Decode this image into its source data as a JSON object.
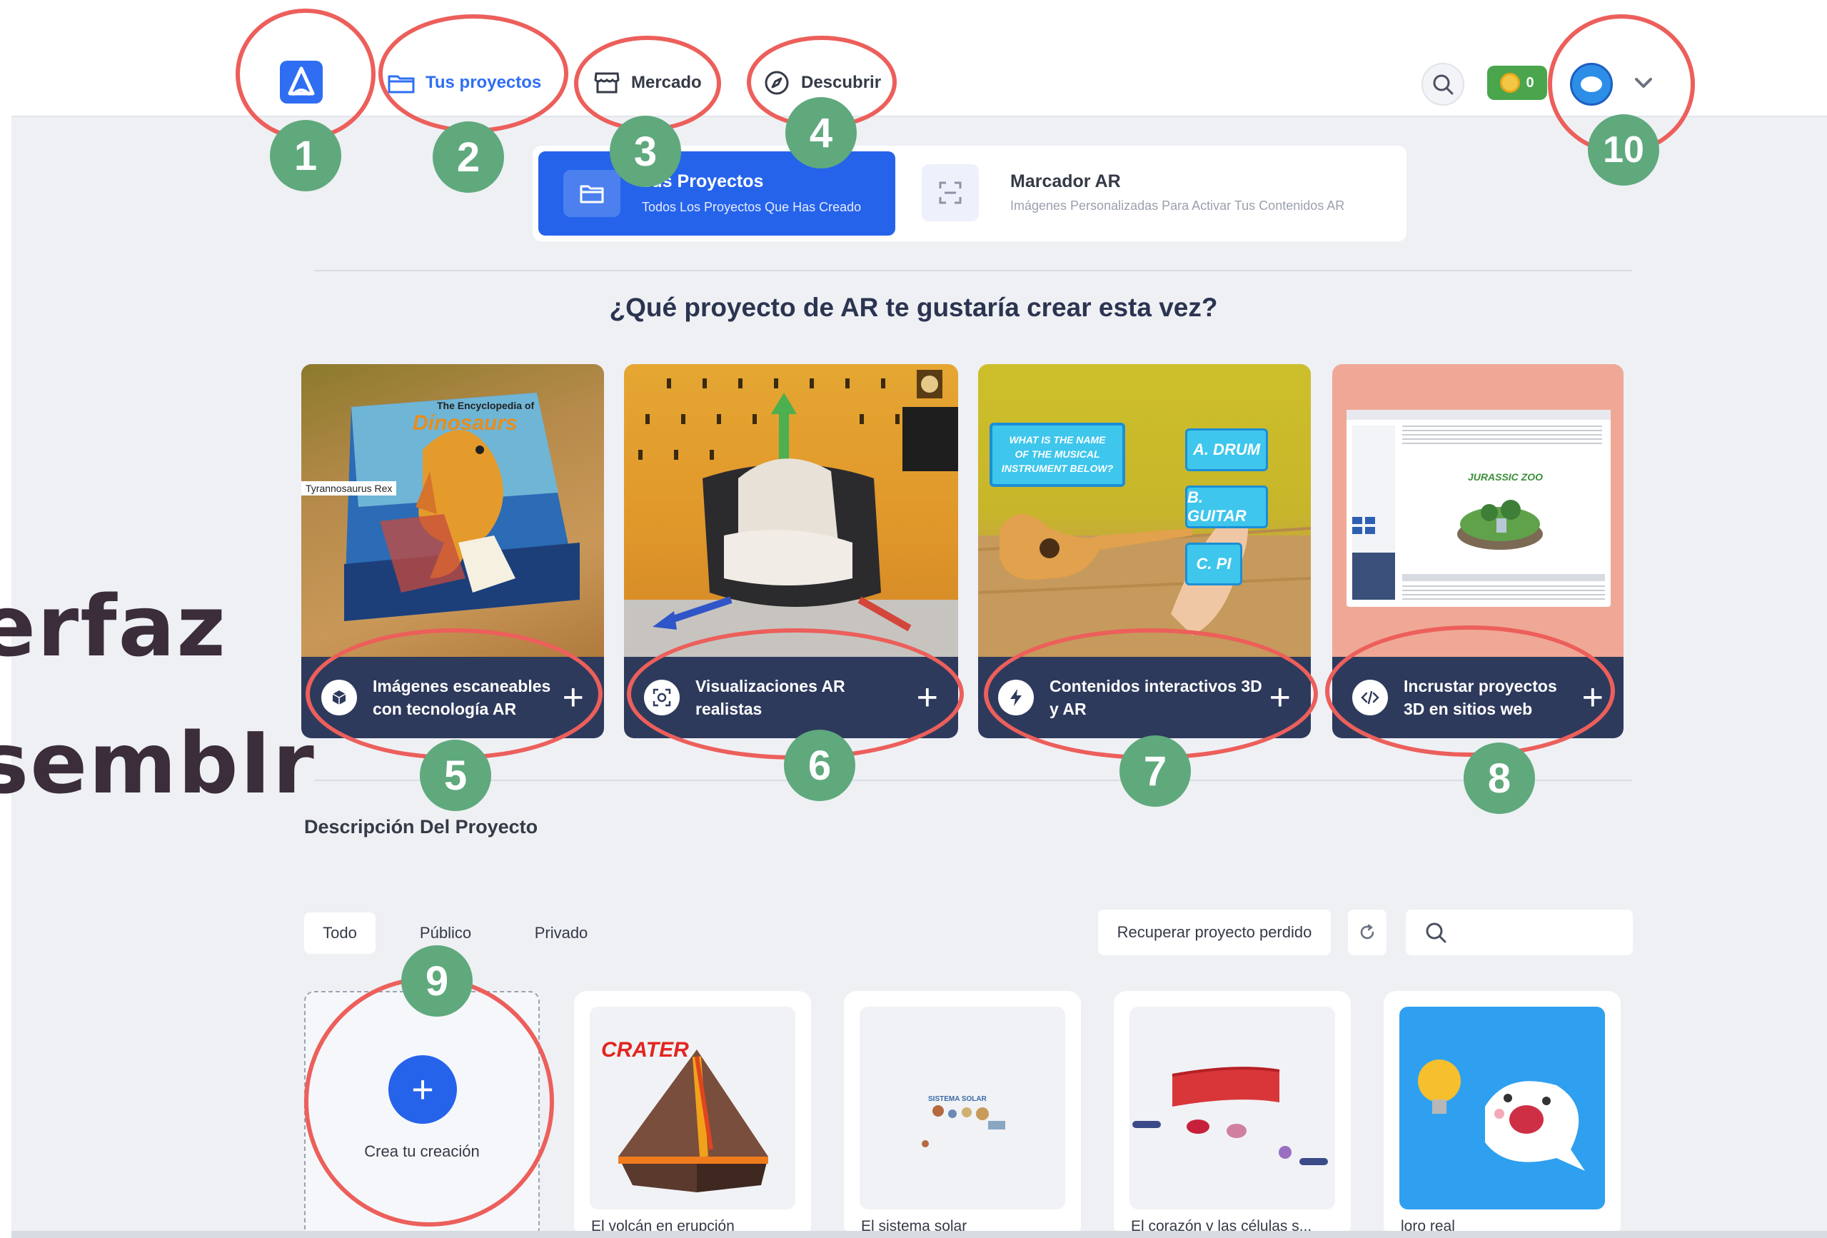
{
  "nav": {
    "items": [
      {
        "label": "Tus proyectos",
        "active": true,
        "icon": "folder-icon"
      },
      {
        "label": "Mercado",
        "active": false,
        "icon": "store-icon"
      },
      {
        "label": "Descubrir",
        "active": false,
        "icon": "compass-icon"
      }
    ],
    "coins": "0"
  },
  "subtabs": [
    {
      "title": "Tus Proyectos",
      "subtitle": "Todos Los Proyectos Que Has Creado",
      "active": true,
      "icon": "folder-icon"
    },
    {
      "title": "Marcador AR",
      "subtitle": "Imágenes Personalizadas Para Activar Tus Contenidos AR",
      "active": false,
      "icon": "scan-icon"
    }
  ],
  "question": "¿Qué proyecto de AR te gustaría crear esta vez?",
  "cards": [
    {
      "label": "Imágenes escaneables\ncon tecnología AR",
      "icon": "cube-icon",
      "art_title": "The Encyclopedia of",
      "art_word": "Dinosaurs",
      "art_tag": "Tyrannosaurus Rex"
    },
    {
      "label": "Visualizaciones AR\nrealistas",
      "icon": "ar-view-icon"
    },
    {
      "label": "Contenidos interactivos 3D\ny AR",
      "icon": "lightning-icon",
      "art_question": "WHAT IS THE NAME OF THE MUSICAL INSTRUMENT BELOW?",
      "art_options": [
        "A. DRUM",
        "B. GUITAR",
        "C. PI"
      ]
    },
    {
      "label": "Incrustar proyectos\n3D en sitios web",
      "icon": "code-icon",
      "art_title": "JURASSIC ZOO"
    }
  ],
  "section_title": "Descripción Del Proyecto",
  "filters": [
    "Todo",
    "Público",
    "Privado"
  ],
  "recover_label": "Recuperar proyecto perdido",
  "create_label": "Crea tu creación",
  "projects": [
    {
      "name": "El volcán en erupción",
      "thumb_text": "CRATER"
    },
    {
      "name": "El sistema solar",
      "thumb_text": "SISTEMA SOLAR"
    },
    {
      "name": "El corazón y las células s..."
    },
    {
      "name": "loro real"
    }
  ],
  "side_text": [
    "erfaz",
    "sembIr"
  ],
  "annotations": [
    "1",
    "2",
    "3",
    "4",
    "5",
    "6",
    "7",
    "8",
    "9",
    "10"
  ],
  "colors": {
    "accent": "#2563eb",
    "annotation_red": "#ec5f5b",
    "badge_green": "#5fa97d",
    "card_bar": "#2e3a5c"
  }
}
